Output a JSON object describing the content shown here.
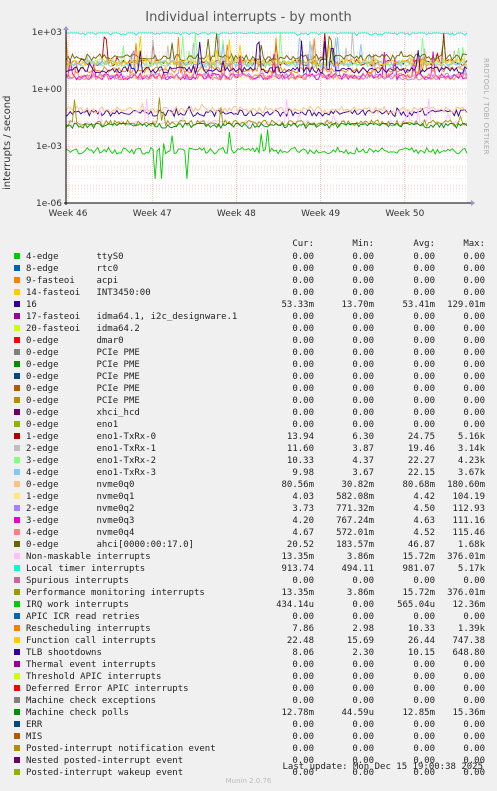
{
  "chart_data": {
    "type": "line",
    "title": "Individual interrupts - by month",
    "ylabel": "interrupts / second",
    "y_scale": "log",
    "ylim": [
      1e-06,
      1000
    ],
    "y_ticks": [
      "1e-06",
      "1e-03",
      "1e+00",
      "1e+03"
    ],
    "x_ticks": [
      "Week 46",
      "Week 47",
      "Week 48",
      "Week 49",
      "Week 50"
    ],
    "grid": true,
    "columns": [
      "Cur:",
      "Min:",
      "Avg:",
      "Max:"
    ],
    "series": [
      {
        "src": "4-edge",
        "name": "ttyS0",
        "color": "#00cc00",
        "cur": "0.00",
        "min": "0.00",
        "avg": "0.00",
        "max": "0.00"
      },
      {
        "src": "8-edge",
        "name": "rtc0",
        "color": "#0066b3",
        "cur": "0.00",
        "min": "0.00",
        "avg": "0.00",
        "max": "0.00"
      },
      {
        "src": "9-fasteoi",
        "name": "acpi",
        "color": "#ff8000",
        "cur": "0.00",
        "min": "0.00",
        "avg": "0.00",
        "max": "0.00"
      },
      {
        "src": "14-fasteoi",
        "name": "INT3450:00",
        "color": "#ffcc00",
        "cur": "0.00",
        "min": "0.00",
        "avg": "0.00",
        "max": "0.00"
      },
      {
        "src": "16",
        "name": "",
        "color": "#330099",
        "cur": "53.33m",
        "min": "13.70m",
        "avg": "53.41m",
        "max": "129.01m"
      },
      {
        "src": "17-fasteoi",
        "name": "idma64.1, i2c_designware.1",
        "color": "#990099",
        "cur": "0.00",
        "min": "0.00",
        "avg": "0.00",
        "max": "0.00"
      },
      {
        "src": "20-fasteoi",
        "name": "idma64.2",
        "color": "#ccff00",
        "cur": "0.00",
        "min": "0.00",
        "avg": "0.00",
        "max": "0.00"
      },
      {
        "src": "0-edge",
        "name": "dmar0",
        "color": "#ff0000",
        "cur": "0.00",
        "min": "0.00",
        "avg": "0.00",
        "max": "0.00"
      },
      {
        "src": "0-edge",
        "name": "PCIe PME",
        "color": "#808080",
        "cur": "0.00",
        "min": "0.00",
        "avg": "0.00",
        "max": "0.00"
      },
      {
        "src": "0-edge",
        "name": "PCIe PME",
        "color": "#008f00",
        "cur": "0.00",
        "min": "0.00",
        "avg": "0.00",
        "max": "0.00"
      },
      {
        "src": "0-edge",
        "name": "PCIe PME",
        "color": "#00487d",
        "cur": "0.00",
        "min": "0.00",
        "avg": "0.00",
        "max": "0.00"
      },
      {
        "src": "0-edge",
        "name": "PCIe PME",
        "color": "#b35a00",
        "cur": "0.00",
        "min": "0.00",
        "avg": "0.00",
        "max": "0.00"
      },
      {
        "src": "0-edge",
        "name": "PCIe PME",
        "color": "#b38f00",
        "cur": "0.00",
        "min": "0.00",
        "avg": "0.00",
        "max": "0.00"
      },
      {
        "src": "0-edge",
        "name": "xhci_hcd",
        "color": "#6b006b",
        "cur": "0.00",
        "min": "0.00",
        "avg": "0.00",
        "max": "0.00"
      },
      {
        "src": "0-edge",
        "name": "eno1",
        "color": "#8fb300",
        "cur": "0.00",
        "min": "0.00",
        "avg": "0.00",
        "max": "0.00"
      },
      {
        "src": "1-edge",
        "name": "eno1-TxRx-0",
        "color": "#b30000",
        "cur": "13.94",
        "min": "6.30",
        "avg": "24.75",
        "max": "5.16k"
      },
      {
        "src": "2-edge",
        "name": "eno1-TxRx-1",
        "color": "#bebebe",
        "cur": "11.60",
        "min": "3.87",
        "avg": "19.46",
        "max": "3.14k"
      },
      {
        "src": "3-edge",
        "name": "eno1-TxRx-2",
        "color": "#80ff80",
        "cur": "10.33",
        "min": "4.37",
        "avg": "22.27",
        "max": "4.23k"
      },
      {
        "src": "4-edge",
        "name": "eno1-TxRx-3",
        "color": "#80c9ff",
        "cur": "9.98",
        "min": "3.67",
        "avg": "22.15",
        "max": "3.67k"
      },
      {
        "src": "0-edge",
        "name": "nvme0q0",
        "color": "#ffc080",
        "cur": "80.56m",
        "min": "30.82m",
        "avg": "80.68m",
        "max": "180.60m"
      },
      {
        "src": "1-edge",
        "name": "nvme0q1",
        "color": "#ffe680",
        "cur": "4.03",
        "min": "582.08m",
        "avg": "4.42",
        "max": "104.19"
      },
      {
        "src": "2-edge",
        "name": "nvme0q2",
        "color": "#aa80ff",
        "cur": "3.73",
        "min": "771.32m",
        "avg": "4.50",
        "max": "112.93"
      },
      {
        "src": "3-edge",
        "name": "nvme0q3",
        "color": "#ee00cc",
        "cur": "4.20",
        "min": "767.24m",
        "avg": "4.63",
        "max": "111.16"
      },
      {
        "src": "4-edge",
        "name": "nvme0q4",
        "color": "#ff8080",
        "cur": "4.67",
        "min": "572.01m",
        "avg": "4.52",
        "max": "115.46"
      },
      {
        "src": "0-edge",
        "name": "ahci[0000:00:17.0]",
        "color": "#666600",
        "cur": "20.52",
        "min": "183.57m",
        "avg": "46.87",
        "max": "1.68k"
      },
      {
        "src": "Non-maskable interrupts",
        "name": "",
        "color": "#ffbfff",
        "cur": "13.35m",
        "min": "3.86m",
        "avg": "15.72m",
        "max": "376.01m"
      },
      {
        "src": "Local timer interrupts",
        "name": "",
        "color": "#00ffcc",
        "cur": "913.74",
        "min": "494.11",
        "avg": "981.07",
        "max": "5.17k"
      },
      {
        "src": "Spurious interrupts",
        "name": "",
        "color": "#cc6699",
        "cur": "0.00",
        "min": "0.00",
        "avg": "0.00",
        "max": "0.00"
      },
      {
        "src": "Performance monitoring interrupts",
        "name": "",
        "color": "#999900",
        "cur": "13.35m",
        "min": "3.86m",
        "avg": "15.72m",
        "max": "376.01m"
      },
      {
        "src": "IRQ work interrupts",
        "name": "",
        "color": "#00cc00",
        "cur": "434.14u",
        "min": "0.00",
        "avg": "565.04u",
        "max": "12.36m"
      },
      {
        "src": "APIC ICR read retries",
        "name": "",
        "color": "#0066b3",
        "cur": "0.00",
        "min": "0.00",
        "avg": "0.00",
        "max": "0.00"
      },
      {
        "src": "Rescheduling interrupts",
        "name": "",
        "color": "#ff8000",
        "cur": "7.86",
        "min": "2.98",
        "avg": "10.33",
        "max": "1.39k"
      },
      {
        "src": "Function call interrupts",
        "name": "",
        "color": "#ffcc00",
        "cur": "22.48",
        "min": "15.69",
        "avg": "26.44",
        "max": "747.38"
      },
      {
        "src": "TLB shootdowns",
        "name": "",
        "color": "#330099",
        "cur": "8.06",
        "min": "2.30",
        "avg": "10.15",
        "max": "648.80"
      },
      {
        "src": "Thermal event interrupts",
        "name": "",
        "color": "#990099",
        "cur": "0.00",
        "min": "0.00",
        "avg": "0.00",
        "max": "0.00"
      },
      {
        "src": "Threshold APIC interrupts",
        "name": "",
        "color": "#ccff00",
        "cur": "0.00",
        "min": "0.00",
        "avg": "0.00",
        "max": "0.00"
      },
      {
        "src": "Deferred Error APIC interrupts",
        "name": "",
        "color": "#ff0000",
        "cur": "0.00",
        "min": "0.00",
        "avg": "0.00",
        "max": "0.00"
      },
      {
        "src": "Machine check exceptions",
        "name": "",
        "color": "#808080",
        "cur": "0.00",
        "min": "0.00",
        "avg": "0.00",
        "max": "0.00"
      },
      {
        "src": "Machine check polls",
        "name": "",
        "color": "#008f00",
        "cur": "12.78m",
        "min": "44.59u",
        "avg": "12.85m",
        "max": "15.36m"
      },
      {
        "src": "ERR",
        "name": "",
        "color": "#00487d",
        "cur": "0.00",
        "min": "0.00",
        "avg": "0.00",
        "max": "0.00"
      },
      {
        "src": "MIS",
        "name": "",
        "color": "#b35a00",
        "cur": "0.00",
        "min": "0.00",
        "avg": "0.00",
        "max": "0.00"
      },
      {
        "src": "Posted-interrupt notification event",
        "name": "",
        "color": "#b38f00",
        "cur": "0.00",
        "min": "0.00",
        "avg": "0.00",
        "max": "0.00"
      },
      {
        "src": "Nested posted-interrupt event",
        "name": "",
        "color": "#6b006b",
        "cur": "0.00",
        "min": "0.00",
        "avg": "0.00",
        "max": "0.00"
      },
      {
        "src": "Posted-interrupt wakeup event",
        "name": "",
        "color": "#8fb300",
        "cur": "0.00",
        "min": "0.00",
        "avg": "0.00",
        "max": "0.00"
      }
    ]
  },
  "last_update": "Last update: Mon Dec 15 19:00:38 2025",
  "side_credit": "RRDTOOL / TOBI OETIKER",
  "footer": "Munin 2.0.76"
}
